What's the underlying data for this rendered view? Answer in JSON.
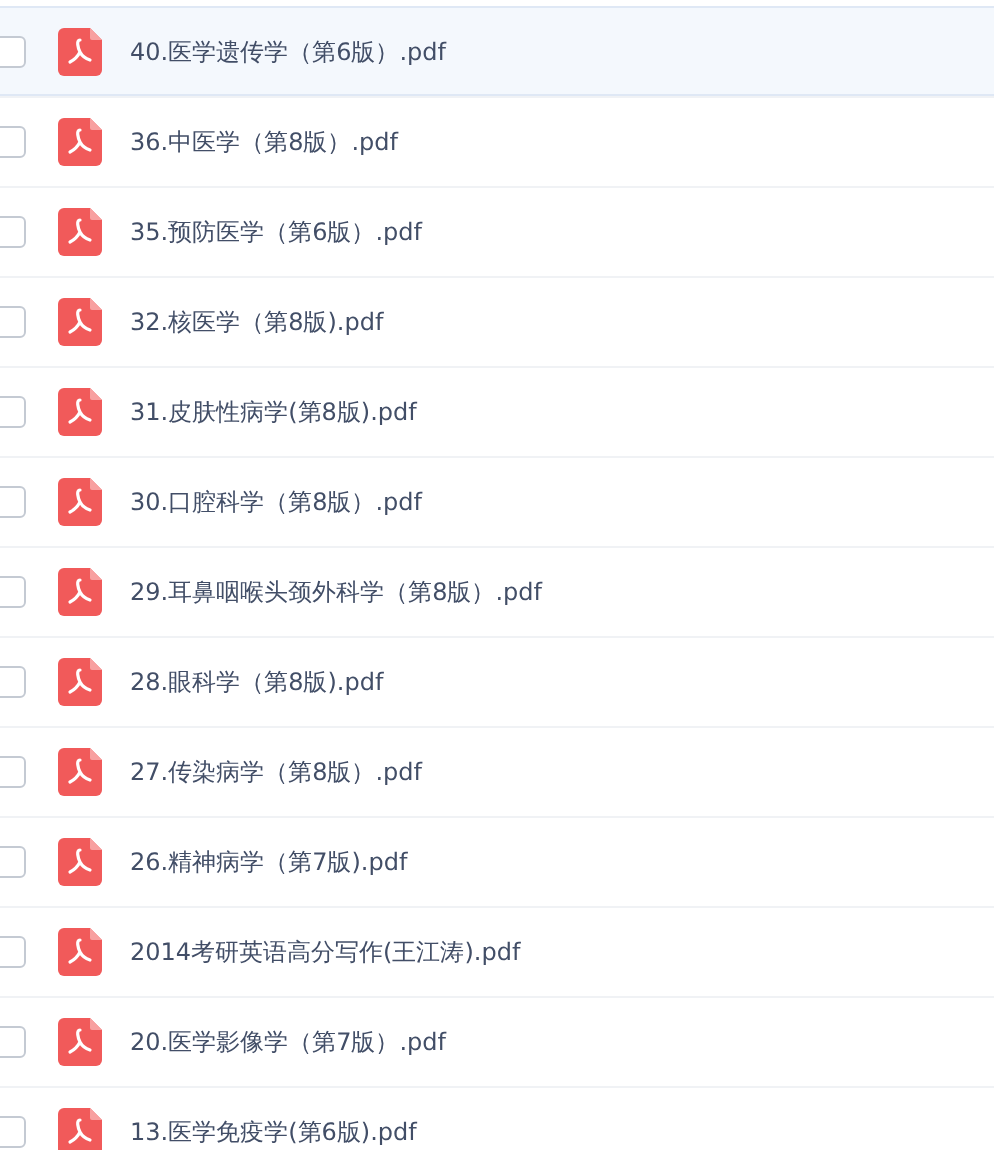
{
  "files": [
    {
      "name": "40.医学遗传学（第6版）.pdf",
      "selected": true,
      "checked": false
    },
    {
      "name": "36.中医学（第8版）.pdf",
      "selected": false,
      "checked": false
    },
    {
      "name": "35.预防医学（第6版）.pdf",
      "selected": false,
      "checked": false
    },
    {
      "name": "32.核医学（第8版).pdf",
      "selected": false,
      "checked": false
    },
    {
      "name": "31.皮肤性病学(第8版).pdf",
      "selected": false,
      "checked": false
    },
    {
      "name": "30.口腔科学（第8版）.pdf",
      "selected": false,
      "checked": false
    },
    {
      "name": "29.耳鼻咽喉头颈外科学（第8版）.pdf",
      "selected": false,
      "checked": false
    },
    {
      "name": "28.眼科学（第8版).pdf",
      "selected": false,
      "checked": false
    },
    {
      "name": "27.传染病学（第8版）.pdf",
      "selected": false,
      "checked": false
    },
    {
      "name": "26.精神病学（第7版).pdf",
      "selected": false,
      "checked": false
    },
    {
      "name": "2014考研英语高分写作(王江涛).pdf",
      "selected": false,
      "checked": false
    },
    {
      "name": "20.医学影像学（第7版）.pdf",
      "selected": false,
      "checked": false
    },
    {
      "name": "13.医学免疫学(第6版).pdf",
      "selected": false,
      "checked": false
    }
  ]
}
